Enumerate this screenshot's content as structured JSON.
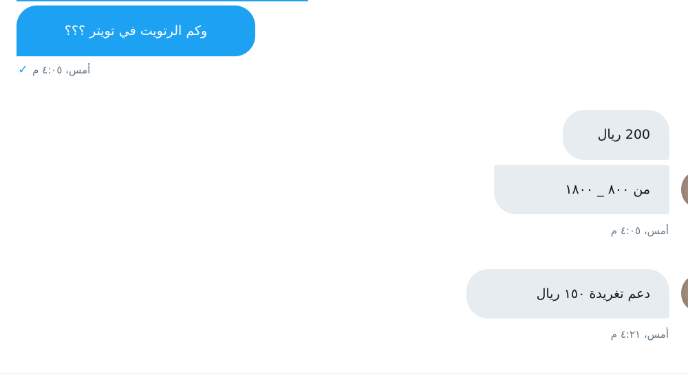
{
  "conversation": {
    "sent": {
      "text": "وكم الرتويت في تويتر ؟؟؟",
      "timestamp": "أمس، ٤:٠٥ م",
      "status_icon": "check-icon",
      "status_glyph": "✓"
    },
    "received_group_1": {
      "messages": [
        "200 ريال",
        "من ٨٠٠ _ ١٨٠٠"
      ],
      "timestamp": "أمس، ٤:٠٥ م"
    },
    "received_group_2": {
      "messages": [
        "دعم تغريدة ١٥٠ ريال"
      ],
      "timestamp": "أمس، ٤:٢١ م"
    }
  },
  "colors": {
    "sent_bubble": "#1da1f2",
    "received_bubble": "#e6ecf0",
    "timestamp": "#657786"
  }
}
